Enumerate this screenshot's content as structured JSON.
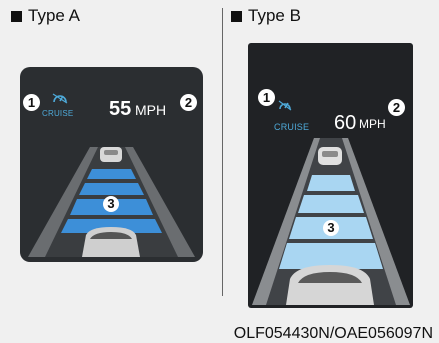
{
  "type_a": {
    "header": "Type A",
    "cruise_label": "CRUISE",
    "speed_value": "55",
    "speed_unit": "MPH",
    "callouts": [
      "1",
      "2"
    ],
    "distance_level": "3"
  },
  "type_b": {
    "header": "Type B",
    "cruise_label": "CRUISE",
    "speed_value": "60",
    "speed_unit": "MPH",
    "callouts": [
      "1",
      "2"
    ],
    "distance_level": "3"
  },
  "caption": "OLF054430N/OAE056097N",
  "colors": {
    "cruise": "#4ea9d8",
    "bar_a": "#3d8fd8",
    "bar_b": "#a9d6f2",
    "panel": "#2b2e31"
  }
}
